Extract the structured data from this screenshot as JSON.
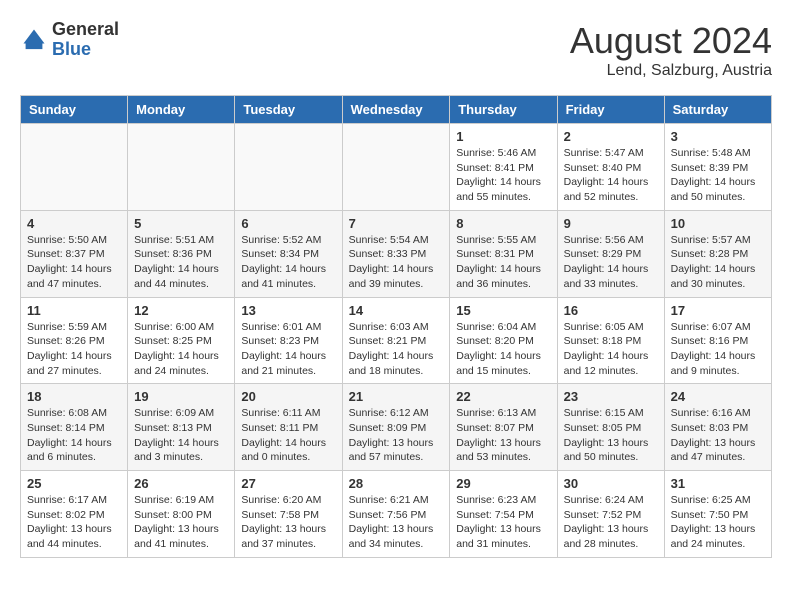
{
  "header": {
    "logo_general": "General",
    "logo_blue": "Blue",
    "month_year": "August 2024",
    "location": "Lend, Salzburg, Austria"
  },
  "weekdays": [
    "Sunday",
    "Monday",
    "Tuesday",
    "Wednesday",
    "Thursday",
    "Friday",
    "Saturday"
  ],
  "weeks": [
    [
      {
        "day": "",
        "empty": true
      },
      {
        "day": "",
        "empty": true
      },
      {
        "day": "",
        "empty": true
      },
      {
        "day": "",
        "empty": true
      },
      {
        "day": "1",
        "sunrise": "5:46 AM",
        "sunset": "8:41 PM",
        "daylight": "14 hours and 55 minutes."
      },
      {
        "day": "2",
        "sunrise": "5:47 AM",
        "sunset": "8:40 PM",
        "daylight": "14 hours and 52 minutes."
      },
      {
        "day": "3",
        "sunrise": "5:48 AM",
        "sunset": "8:39 PM",
        "daylight": "14 hours and 50 minutes."
      }
    ],
    [
      {
        "day": "4",
        "sunrise": "5:50 AM",
        "sunset": "8:37 PM",
        "daylight": "14 hours and 47 minutes."
      },
      {
        "day": "5",
        "sunrise": "5:51 AM",
        "sunset": "8:36 PM",
        "daylight": "14 hours and 44 minutes."
      },
      {
        "day": "6",
        "sunrise": "5:52 AM",
        "sunset": "8:34 PM",
        "daylight": "14 hours and 41 minutes."
      },
      {
        "day": "7",
        "sunrise": "5:54 AM",
        "sunset": "8:33 PM",
        "daylight": "14 hours and 39 minutes."
      },
      {
        "day": "8",
        "sunrise": "5:55 AM",
        "sunset": "8:31 PM",
        "daylight": "14 hours and 36 minutes."
      },
      {
        "day": "9",
        "sunrise": "5:56 AM",
        "sunset": "8:29 PM",
        "daylight": "14 hours and 33 minutes."
      },
      {
        "day": "10",
        "sunrise": "5:57 AM",
        "sunset": "8:28 PM",
        "daylight": "14 hours and 30 minutes."
      }
    ],
    [
      {
        "day": "11",
        "sunrise": "5:59 AM",
        "sunset": "8:26 PM",
        "daylight": "14 hours and 27 minutes."
      },
      {
        "day": "12",
        "sunrise": "6:00 AM",
        "sunset": "8:25 PM",
        "daylight": "14 hours and 24 minutes."
      },
      {
        "day": "13",
        "sunrise": "6:01 AM",
        "sunset": "8:23 PM",
        "daylight": "14 hours and 21 minutes."
      },
      {
        "day": "14",
        "sunrise": "6:03 AM",
        "sunset": "8:21 PM",
        "daylight": "14 hours and 18 minutes."
      },
      {
        "day": "15",
        "sunrise": "6:04 AM",
        "sunset": "8:20 PM",
        "daylight": "14 hours and 15 minutes."
      },
      {
        "day": "16",
        "sunrise": "6:05 AM",
        "sunset": "8:18 PM",
        "daylight": "14 hours and 12 minutes."
      },
      {
        "day": "17",
        "sunrise": "6:07 AM",
        "sunset": "8:16 PM",
        "daylight": "14 hours and 9 minutes."
      }
    ],
    [
      {
        "day": "18",
        "sunrise": "6:08 AM",
        "sunset": "8:14 PM",
        "daylight": "14 hours and 6 minutes."
      },
      {
        "day": "19",
        "sunrise": "6:09 AM",
        "sunset": "8:13 PM",
        "daylight": "14 hours and 3 minutes."
      },
      {
        "day": "20",
        "sunrise": "6:11 AM",
        "sunset": "8:11 PM",
        "daylight": "14 hours and 0 minutes."
      },
      {
        "day": "21",
        "sunrise": "6:12 AM",
        "sunset": "8:09 PM",
        "daylight": "13 hours and 57 minutes."
      },
      {
        "day": "22",
        "sunrise": "6:13 AM",
        "sunset": "8:07 PM",
        "daylight": "13 hours and 53 minutes."
      },
      {
        "day": "23",
        "sunrise": "6:15 AM",
        "sunset": "8:05 PM",
        "daylight": "13 hours and 50 minutes."
      },
      {
        "day": "24",
        "sunrise": "6:16 AM",
        "sunset": "8:03 PM",
        "daylight": "13 hours and 47 minutes."
      }
    ],
    [
      {
        "day": "25",
        "sunrise": "6:17 AM",
        "sunset": "8:02 PM",
        "daylight": "13 hours and 44 minutes."
      },
      {
        "day": "26",
        "sunrise": "6:19 AM",
        "sunset": "8:00 PM",
        "daylight": "13 hours and 41 minutes."
      },
      {
        "day": "27",
        "sunrise": "6:20 AM",
        "sunset": "7:58 PM",
        "daylight": "13 hours and 37 minutes."
      },
      {
        "day": "28",
        "sunrise": "6:21 AM",
        "sunset": "7:56 PM",
        "daylight": "13 hours and 34 minutes."
      },
      {
        "day": "29",
        "sunrise": "6:23 AM",
        "sunset": "7:54 PM",
        "daylight": "13 hours and 31 minutes."
      },
      {
        "day": "30",
        "sunrise": "6:24 AM",
        "sunset": "7:52 PM",
        "daylight": "13 hours and 28 minutes."
      },
      {
        "day": "31",
        "sunrise": "6:25 AM",
        "sunset": "7:50 PM",
        "daylight": "13 hours and 24 minutes."
      }
    ]
  ]
}
